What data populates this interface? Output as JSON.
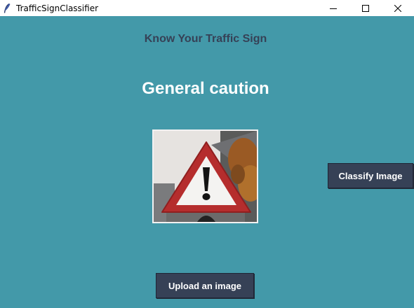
{
  "window": {
    "title": "TrafficSignClassifier",
    "icon": "feather-icon",
    "controls": [
      "minimize-icon",
      "maximize-icon",
      "close-icon"
    ]
  },
  "heading": "Know Your Traffic Sign",
  "prediction": "General caution",
  "image": {
    "description_icon": "general-caution-sign-icon"
  },
  "buttons": {
    "classify": "Classify Image",
    "upload": "Upload an image"
  },
  "colors": {
    "background": "#4399a9",
    "button": "#364156",
    "heading": "#364156",
    "prediction": "#ffffff"
  }
}
